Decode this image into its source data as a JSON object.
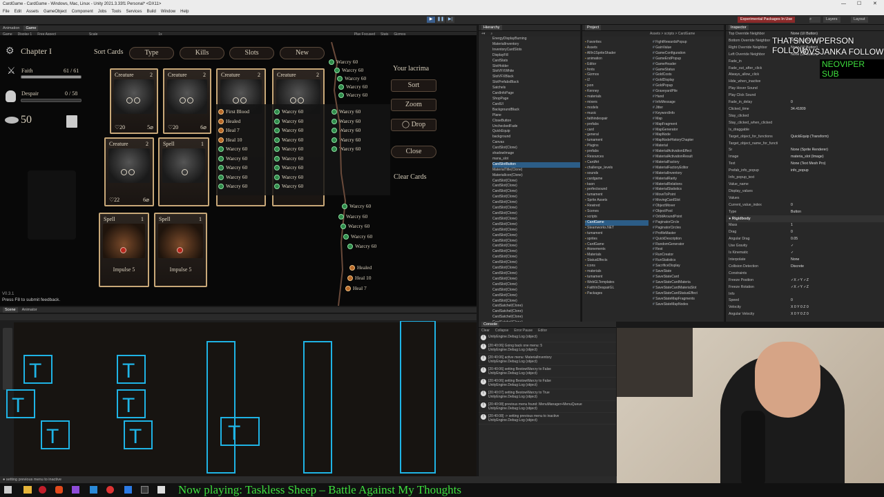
{
  "window": {
    "title": "CardGame - CardGame - Windows, Mac, Linux - Unity 2021.3.33f1 Personal* <DX11>",
    "menu": [
      "File",
      "Edit",
      "Assets",
      "GameObject",
      "Component",
      "Jobs",
      "Tools",
      "Services",
      "Build",
      "Window",
      "Help"
    ]
  },
  "toolbar": {
    "experimental": "Experimental Packages In Use",
    "layers": "Layers",
    "layout": "Layout"
  },
  "game_view": {
    "tabs": [
      "Animation",
      "Game"
    ],
    "controls": [
      "Game",
      "Display 1",
      "Free Aspect",
      "Scale",
      "1x",
      "Play Focused",
      "Stats",
      "Gizmos"
    ],
    "chapter": "Chapter I",
    "sort_cards_label": "Sort Cards",
    "sort_buttons": [
      "Type",
      "Kills",
      "Slots",
      "New"
    ],
    "faith_label": "Faith",
    "faith_value": "61 / 61",
    "despair_label": "Despair",
    "despair_value": "0 / 58",
    "coins": "50",
    "version": "V0.3.1",
    "feedback": "Press F8 to submit feedback.",
    "lacrima_label": "Your lacrima",
    "side_buttons": [
      "Sort",
      "Zoom",
      "Drop",
      "Close",
      "Clear Cards"
    ],
    "cards_row1": [
      {
        "type": "Creature",
        "cost": "2",
        "left": "20",
        "right": "5"
      },
      {
        "type": "Creature",
        "cost": "2",
        "left": "20",
        "right": "6"
      },
      {
        "type": "Creature",
        "cost": "2"
      },
      {
        "type": "Creature",
        "cost": "2"
      }
    ],
    "cards_row2": [
      {
        "type": "Creature",
        "cost": "2",
        "left": "22",
        "right": "6"
      },
      {
        "type": "Spell",
        "cost": "1"
      }
    ],
    "cards_row3": [
      {
        "type": "Spell",
        "cost": "1",
        "name": "Impulse 5"
      },
      {
        "type": "Spell",
        "cost": "1",
        "name": "Impulse 5"
      }
    ],
    "list_col1": [
      "First Blood",
      "Healed",
      "Heal 7",
      "Heal 10",
      "Warcry 60",
      "Warcry 60",
      "Warcry 60",
      "Warcry 60",
      "Warcry 60"
    ],
    "list_col2": [
      "Warcry 60",
      "Warcry 60",
      "Warcry 60",
      "Warcry 60",
      "Warcry 60",
      "Warcry 60",
      "Warcry 60",
      "Warcry 60",
      "Warcry 60"
    ],
    "list_col3": [
      "Warcry 60",
      "Warcry 60",
      "Warcry 60",
      "Warcry 60",
      "Warcry 60"
    ],
    "map_top": [
      "Warcry 60",
      "Warcry 60",
      "Warcry 60",
      "Warcry 60",
      "Warcry 60"
    ],
    "map_bottom": [
      "Warcry 60",
      "Warcry 60",
      "Warcry 60",
      "Warcry 60",
      "Warcry 60",
      "Healed",
      "Heal 10",
      "Heal 7"
    ]
  },
  "hierarchy": {
    "tab": "Hierarchy",
    "items": [
      "EnergyDisplayBurning",
      "MaterialInventory",
      "InventoryCardSlots",
      "DisplayFill",
      "CardStats",
      "SlotHolder",
      "SlotVFXWhite",
      "SlotVFXBlack",
      "SlotPrefabsBlack",
      "Satchels",
      "CardInfoPage",
      "ShopPage",
      "CardUI",
      "BackgroundBlack",
      "Plane",
      "CloseButton",
      "UncheckedFade",
      "QuickEquip",
      "background",
      "Canvas",
      "CardSlot(Clone)",
      "shadowImage",
      "mana_slot",
      "CardSlotButton",
      "MaterialTitle(Clone)",
      "MaterialIcon(Clone)",
      "CardSlot(Clone)",
      "CardSlot(Clone)",
      "CardSlot(Clone)",
      "CardSlot(Clone)",
      "CardSlot(Clone)",
      "CardSlot(Clone)",
      "CardSlot(Clone)",
      "CardSlot(Clone)",
      "CardSlot(Clone)",
      "CardSlot(Clone)",
      "CardSlot(Clone)",
      "CardSlot(Clone)",
      "CardSlot(Clone)",
      "CardSlot(Clone)",
      "CardSlot(Clone)",
      "CardSlot(Clone)",
      "CardSlot(Clone)",
      "CardSlot(Clone)",
      "CardSlot(Clone)",
      "CardSlot(Clone)",
      "CardSlot(Clone)",
      "CardSlot(Clone)",
      "CardSlot(Clone)",
      "CardSatchel(Clone)",
      "CardSatchel(Clone)",
      "CardSatchel(Clone)",
      "CardSatchel(Clone)"
    ]
  },
  "project": {
    "tab": "Project",
    "breadcrumb": "Assets > scripts > CardGame",
    "folders": [
      "Favorites",
      "Assets",
      "AllIn1SpriteShader",
      "animation",
      "Editor",
      "fonts",
      "Gizmos",
      "i2",
      "json",
      "Kenney",
      "materials",
      "mixers",
      "models",
      "music",
      "faithindespair",
      "prefabs",
      "card",
      "general",
      "tumament",
      "Plugins",
      "prefabs",
      "Resources",
      "CardArt",
      "challenge_levels",
      "sounds",
      "cardgame",
      "kaon",
      "perfectsound",
      "tumament",
      "Sprite Assets",
      "Rewired",
      "Scenes",
      "scripts",
      "CardGame",
      "Steamworks.NET",
      "tumament",
      "sprites",
      "CardGame",
      "Atonements",
      "Materials",
      "StatusEffects",
      "icons",
      "materials",
      "tumament",
      "WebGLTemplates",
      "FaithInDespairGL",
      "Packages"
    ],
    "files": [
      "FightRewardsPopup",
      "GainValue",
      "GameConfiguration",
      "GameEndPopup",
      "GameHeader",
      "GameStatus",
      "GoldCosts",
      "GoldDisplay",
      "GoldPopup",
      "GraveyardPile",
      "Hand",
      "InfoMessage",
      "Jitter",
      "KeywordInfo",
      "Map",
      "MapFragment",
      "MapGenerator",
      "MapNode",
      "MapNodeHistoryChapter",
      "Material",
      "MaterialActivationEffect",
      "MaterialActivationResult",
      "MaterialFactory",
      "MaterialFactoryEditor",
      "MaterialInventory",
      "MaterialRarity",
      "MaterialRelations",
      "MaterialStatistics",
      "MoveToPoint",
      "MovingCardSlot",
      "ObjectMover",
      "ObjectPool",
      "OrbitAroundPoint",
      "PaginatorCircle",
      "PaginatorCircles",
      "ProfileMaster",
      "QuickDescription",
      "RandomGenerator",
      "Rest",
      "RunCreator",
      "RunStatistics",
      "SacrificeDisplay",
      "SaveState",
      "SaveStateCard",
      "SaveStateCardMateria",
      "SaveStateCardMateriaSlot",
      "SaveStateCardStatusEffect",
      "SaveStateMapFragments",
      "SaveStateMapNodes"
    ]
  },
  "inspector": {
    "tab": "Inspector",
    "rows": [
      [
        "Top Override Neighbor",
        "None (UI Button)"
      ],
      [
        "Bottom Override Neighbor",
        "None (UI Button)"
      ],
      [
        "Right Override Neighbor",
        "None (UI Button)"
      ],
      [
        "Left Override Neighbor",
        "None (UI Button)"
      ],
      [
        "Fade_in",
        ""
      ],
      [
        "Fade_out_after_click",
        ""
      ],
      [
        "Always_allow_click",
        ""
      ],
      [
        "Hide_when_inactive",
        ""
      ],
      [
        "Play Hover Sound",
        ""
      ],
      [
        "Play Click Sound",
        ""
      ],
      [
        "Fade_in_delay",
        "0"
      ],
      [
        "Clicked_time",
        "34.41809"
      ],
      [
        "Stay_clicked",
        ""
      ],
      [
        "Stay_clicked_when_clicked",
        ""
      ],
      [
        "Is_draggable",
        ""
      ],
      [
        "Target_object_for_functions",
        "QuickEquip (Transform)"
      ],
      [
        "Target_object_name_for_functi",
        ""
      ],
      [
        "Sr",
        "None (Sprite Renderer)"
      ],
      [
        "Image",
        "materia_slot (Image)"
      ],
      [
        "Text",
        "None (Text Mesh Pro)"
      ],
      [
        "Prefab_info_popup",
        "info_popup"
      ],
      [
        "Info_popup_text",
        ""
      ],
      [
        "Value_name",
        ""
      ],
      [
        "Display_values",
        ""
      ],
      [
        "Values",
        ""
      ],
      [
        "Current_value_index",
        "0"
      ],
      [
        "Type",
        "Button"
      ]
    ],
    "rigidbody_title": "Rigidbody",
    "rigidbody": [
      [
        "Mass",
        "1"
      ],
      [
        "Drag",
        "0"
      ],
      [
        "Angular Drag",
        "0.05"
      ],
      [
        "Use Gravity",
        "✓"
      ],
      [
        "Is Kinematic",
        "✓"
      ],
      [
        "Interpolate",
        "None"
      ],
      [
        "Collision Detection",
        "Discrete"
      ],
      [
        "Constraints",
        ""
      ],
      [
        "Freeze Position",
        "✓X ✓Y ✓Z"
      ],
      [
        "Freeze Rotation",
        "✓X ✓Y ✓Z"
      ],
      [
        "Info",
        ""
      ],
      [
        "Speed",
        "0"
      ],
      [
        "Velocity",
        "X 0   Y 0   Z 0"
      ],
      [
        "Angular Velocity",
        "X 0   Y 0   Z 0"
      ]
    ]
  },
  "scene_view": {
    "tabs": [
      "Scene",
      "Animator"
    ]
  },
  "console": {
    "tab": "Console",
    "controls": [
      "Clear",
      "Collapse",
      "Error Pause",
      "Editor"
    ],
    "top_line": "UnityEngine.Debug:Log (object)",
    "entries": [
      [
        "[20:40:06] Going back one menu: 5",
        "UnityEngine.Debug:Log (object)"
      ],
      [
        "[20:40:06] active menu: MaterialInventory",
        "UnityEngine.Debug:Log (object)"
      ],
      [
        "[20:40:06] setting BestowWarcry to False",
        "UnityEngine.Debug:Log (object)"
      ],
      [
        "[20:40:06] setting BestowWarcry to False",
        "UnityEngine.Debug:Log (object)"
      ],
      [
        "[20:40:07] setting BestowWarcry to True",
        "UnityEngine.Debug:Log (object)"
      ],
      [
        "[20:40:08] previous menu found: MenuManager+MenuQueue",
        "UnityEngine.Debug:Log (object)"
      ],
      [
        "[20:40:08] -> setting previous menu to inactive",
        "UnityEngine.Debug:Log (object)"
      ]
    ]
  },
  "status_bar": "setting previous menu to inactive",
  "overlays": {
    "follow1": "THATSNOWPERSON FOLLOW",
    "follow2": "OVSJANKA FOLLOW",
    "sub": "NEOVIPER SUB",
    "now_playing": "Now playing: Taskless Sheep – Battle Against My Thoughts"
  }
}
